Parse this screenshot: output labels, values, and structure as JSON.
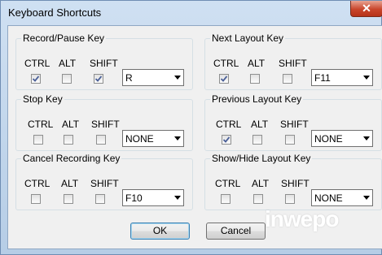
{
  "window": {
    "title": "Keyboard Shortcuts",
    "close_glyph": "✕"
  },
  "labels": {
    "ctrl": "CTRL",
    "alt": "ALT",
    "shift": "SHIFT"
  },
  "groups": [
    {
      "title": "Record/Pause Key",
      "ctrl": true,
      "alt": false,
      "shift": true,
      "key": "R"
    },
    {
      "title": "Next Layout Key",
      "ctrl": true,
      "alt": false,
      "shift": false,
      "key": "F11"
    },
    {
      "title": "Stop Key",
      "ctrl": false,
      "alt": false,
      "shift": false,
      "key": "NONE"
    },
    {
      "title": "Previous Layout Key",
      "ctrl": true,
      "alt": false,
      "shift": false,
      "key": "NONE"
    },
    {
      "title": "Cancel Recording Key",
      "ctrl": false,
      "alt": false,
      "shift": false,
      "key": "F10"
    },
    {
      "title": "Show/Hide Layout Key",
      "ctrl": false,
      "alt": false,
      "shift": false,
      "key": "NONE"
    }
  ],
  "buttons": {
    "ok": "OK",
    "cancel": "Cancel"
  },
  "watermark": "inwepo"
}
